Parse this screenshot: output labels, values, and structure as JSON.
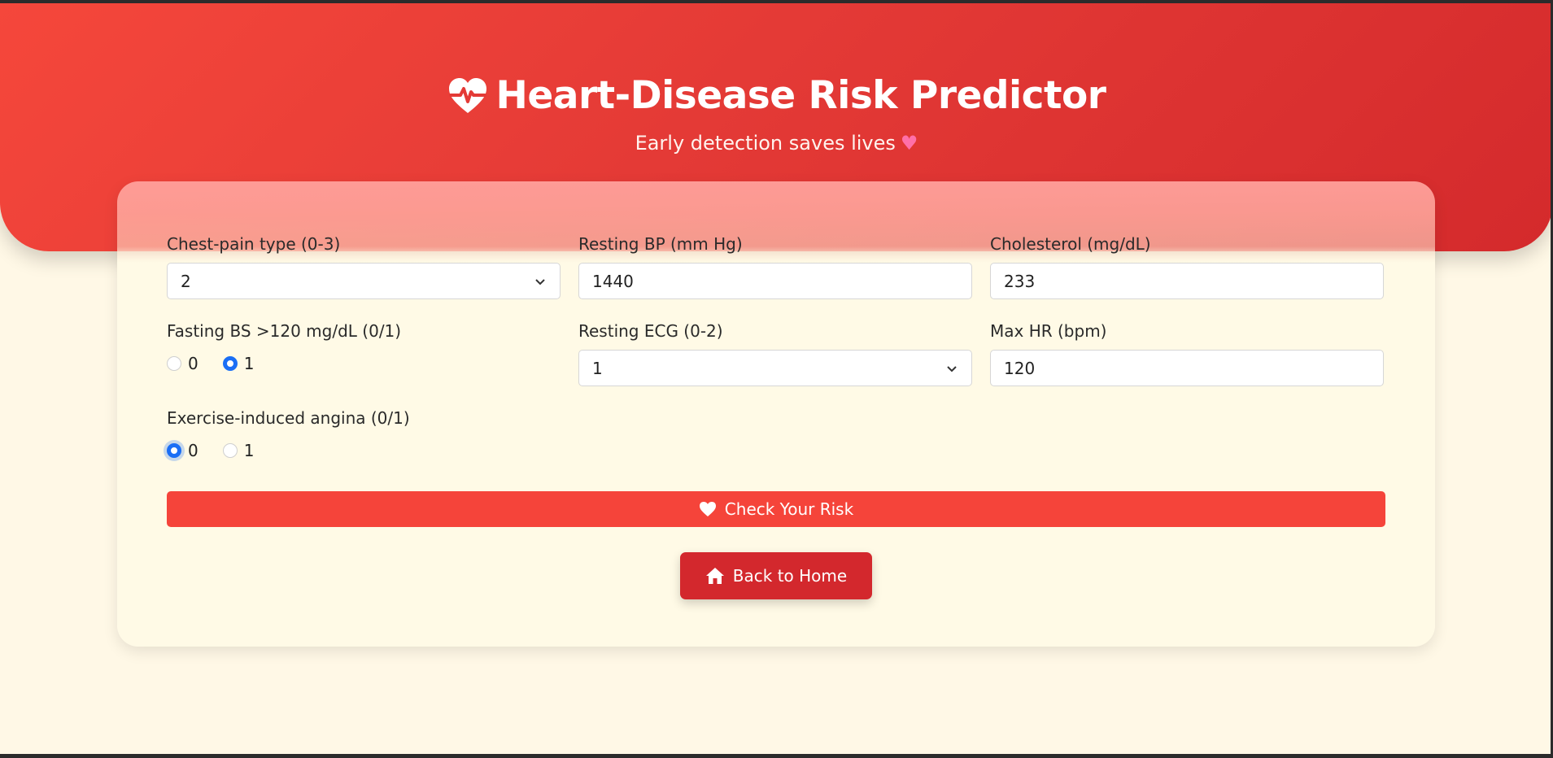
{
  "header": {
    "title": "Heart-Disease Risk Predictor",
    "subtitle": "Early detection saves lives",
    "title_icon": "heart-pulse-icon",
    "subtitle_icon": "pink-heart-icon"
  },
  "form": {
    "chest_pain": {
      "label": "Chest-pain type (0-3)",
      "value": "2"
    },
    "resting_bp": {
      "label": "Resting BP (mm Hg)",
      "value": "1440"
    },
    "cholesterol": {
      "label": "Cholesterol (mg/dL)",
      "value": "233"
    },
    "fasting_bs": {
      "label": "Fasting BS >120 mg/dL (0/1)",
      "options": [
        "0",
        "1"
      ],
      "selected": "1"
    },
    "resting_ecg": {
      "label": "Resting ECG (0-2)",
      "value": "1"
    },
    "max_hr": {
      "label": "Max HR (bpm)",
      "value": "120"
    },
    "angina": {
      "label": "Exercise-induced angina (0/1)",
      "options": [
        "0",
        "1"
      ],
      "selected": "0"
    }
  },
  "buttons": {
    "check_label": "Check Your Risk",
    "home_label": "Back to Home"
  },
  "colors": {
    "hero_start": "#f5473b",
    "hero_end": "#d42a2c",
    "page_bg": "#fff8e6",
    "radio_accent": "#1a6ef5",
    "check_button": "#f5443a",
    "home_button": "#d3282d"
  }
}
